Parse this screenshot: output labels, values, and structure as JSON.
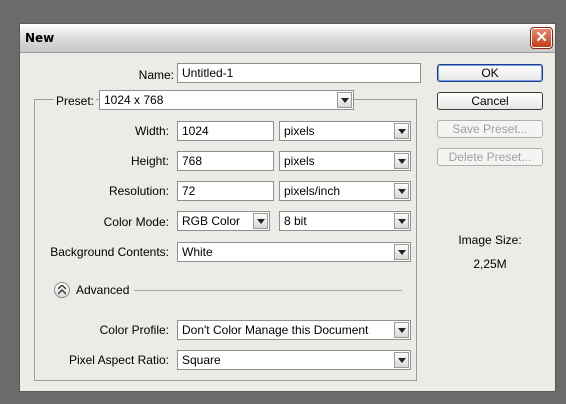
{
  "window": {
    "title": "New",
    "close_label": "✕"
  },
  "name_field": {
    "label": "Name:",
    "value": "Untitled-1"
  },
  "preset": {
    "label": "Preset:",
    "value": "1024 x 768"
  },
  "width": {
    "label": "Width:",
    "value": "1024",
    "unit": "pixels"
  },
  "height": {
    "label": "Height:",
    "value": "768",
    "unit": "pixels"
  },
  "resolution": {
    "label": "Resolution:",
    "value": "72",
    "unit": "pixels/inch"
  },
  "color_mode": {
    "label": "Color Mode:",
    "mode": "RGB Color",
    "depth": "8 bit"
  },
  "background": {
    "label": "Background Contents:",
    "value": "White"
  },
  "advanced": {
    "label": "Advanced"
  },
  "color_profile": {
    "label": "Color Profile:",
    "value": "Don't Color Manage this Document"
  },
  "pixel_aspect": {
    "label": "Pixel Aspect Ratio:",
    "value": "Square"
  },
  "buttons": {
    "ok": "OK",
    "cancel": "Cancel",
    "save_preset": "Save Preset...",
    "delete_preset": "Delete Preset..."
  },
  "image_size": {
    "label": "Image Size:",
    "value": "2,25M"
  }
}
